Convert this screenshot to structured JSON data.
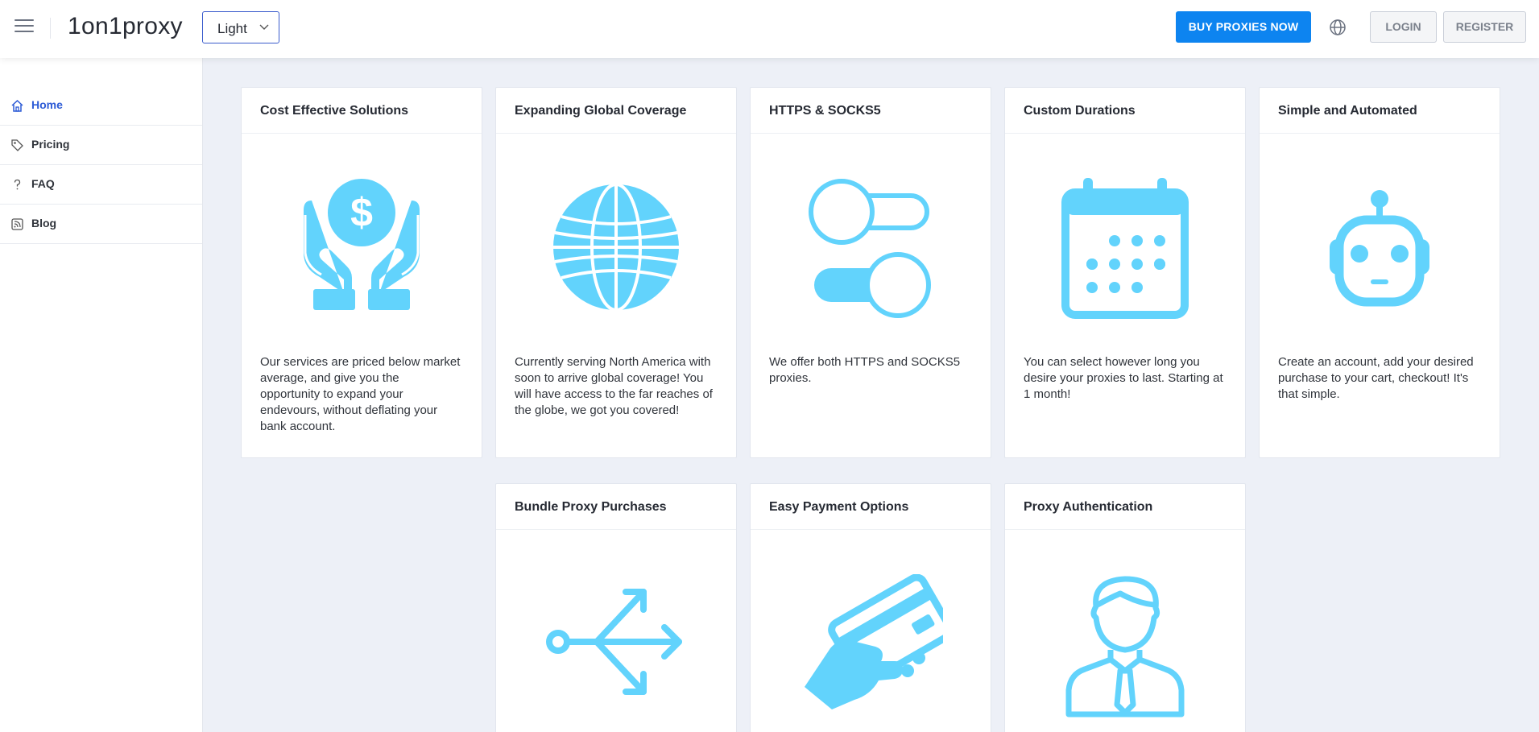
{
  "header": {
    "brand": "1on1proxy",
    "theme_value": "Light",
    "buy_label": "BUY PROXIES NOW",
    "login_label": "LOGIN",
    "register_label": "REGISTER"
  },
  "sidebar": {
    "items": [
      {
        "label": "Home",
        "icon": "home-icon",
        "active": true
      },
      {
        "label": "Pricing",
        "icon": "tag-icon"
      },
      {
        "label": "FAQ",
        "icon": "question-icon"
      },
      {
        "label": "Blog",
        "icon": "rss-icon"
      }
    ]
  },
  "cards": [
    {
      "title": "Cost Effective Solutions",
      "icon": "hands-dollar-icon",
      "text": "Our services are priced below market average, and give you the opportunity to expand your endevours, without deflating your bank account."
    },
    {
      "title": "Expanding Global Coverage",
      "icon": "globe-icon",
      "text": "Currently serving North America with soon to arrive global coverage! You will have access to the far reaches of the globe, we got you covered!"
    },
    {
      "title": "HTTPS & SOCKS5",
      "icon": "toggles-icon",
      "text": "We offer both HTTPS and SOCKS5 proxies."
    },
    {
      "title": "Custom Durations",
      "icon": "calendar-icon",
      "text": "You can select however long you desire your proxies to last. Starting at 1 month!"
    },
    {
      "title": "Simple and Automated",
      "icon": "robot-icon",
      "text": "Create an account, add your desired purchase to your cart, checkout! It's that simple."
    },
    {
      "title": "Bundle Proxy Purchases",
      "icon": "split-arrows-icon",
      "text": ""
    },
    {
      "title": "Easy Payment Options",
      "icon": "credit-card-hand-icon",
      "text": ""
    },
    {
      "title": "Proxy Authentication",
      "icon": "user-tie-icon",
      "text": ""
    }
  ],
  "colors": {
    "accent": "#2d5bd6",
    "buy_button": "#0d84f0",
    "icon_fill": "#62d3fc",
    "background": "#edf0f7"
  }
}
